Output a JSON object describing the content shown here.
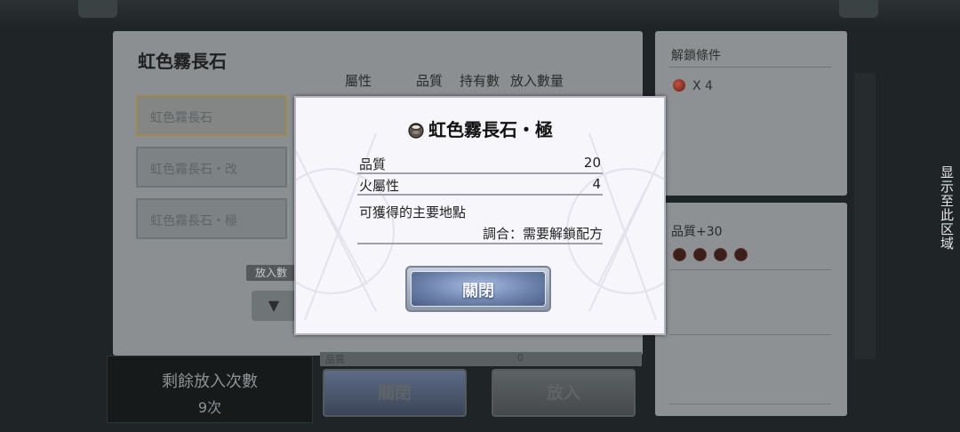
{
  "main": {
    "title": "虹色霧長石",
    "columns": [
      "屬性",
      "品質",
      "持有數",
      "放入數量"
    ],
    "items": [
      {
        "label": "虹色霧長石"
      },
      {
        "label": "虹色霧長石・改"
      },
      {
        "label": "虹色霧長石・極"
      }
    ],
    "put_label": "放入數",
    "arrow": "▼",
    "strip_left": "品質",
    "strip_right": "0"
  },
  "remain": {
    "title": "剩餘放入次數",
    "value": "9次"
  },
  "buttons": {
    "close_label": "關閉",
    "put_label": "放入"
  },
  "unlock": {
    "title": "解鎖條件",
    "count": "X 4"
  },
  "quality": {
    "title": "品質+30",
    "dots": 4
  },
  "side_text": "显示至此区域",
  "modal": {
    "title": "虹色霧長石・極",
    "stats": [
      {
        "key": "品質",
        "value": "20"
      },
      {
        "key": "火屬性",
        "value": "4"
      }
    ],
    "location_title": "可獲得的主要地點",
    "location_value": "調合：需要解鎖配方",
    "close_label": "關閉"
  }
}
